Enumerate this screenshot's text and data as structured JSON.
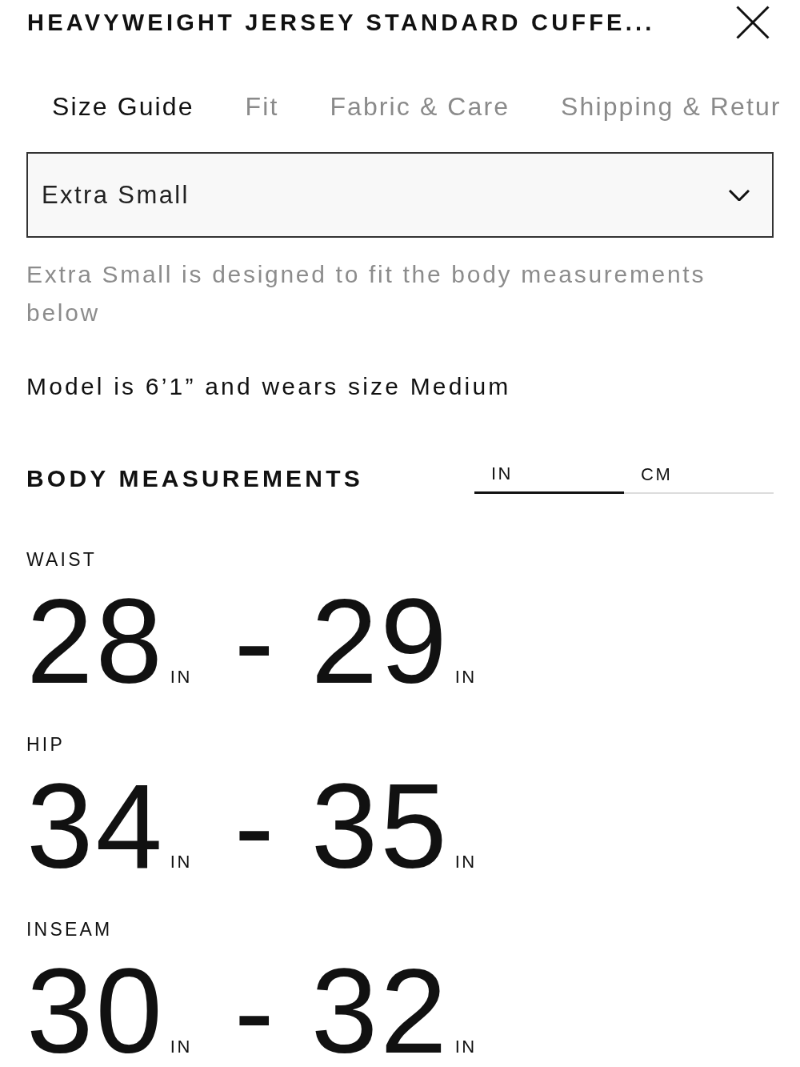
{
  "title": "HEAVYWEIGHT JERSEY STANDARD CUFFE...",
  "tabs": [
    {
      "label": "Size Guide",
      "selected": true
    },
    {
      "label": "Fit",
      "selected": false
    },
    {
      "label": "Fabric & Care",
      "selected": false
    },
    {
      "label": "Shipping & Retur",
      "selected": false
    }
  ],
  "size_select": {
    "value": "Extra Small"
  },
  "size_description": "Extra Small is designed to fit the body measurements below",
  "model_note": "Model is 6’1” and wears size Medium",
  "body_measurements": {
    "heading": "BODY MEASUREMENTS",
    "units": [
      {
        "label": "IN",
        "selected": true
      },
      {
        "label": "CM",
        "selected": false
      }
    ],
    "items": [
      {
        "label": "WAIST",
        "min": "28",
        "min_unit": "IN",
        "separator": "-",
        "max": "29",
        "max_unit": "IN"
      },
      {
        "label": "HIP",
        "min": "34",
        "min_unit": "IN",
        "separator": "-",
        "max": "35",
        "max_unit": "IN"
      },
      {
        "label": "INSEAM",
        "min": "30",
        "min_unit": "IN",
        "separator": "-",
        "max": "32",
        "max_unit": "IN"
      }
    ]
  }
}
